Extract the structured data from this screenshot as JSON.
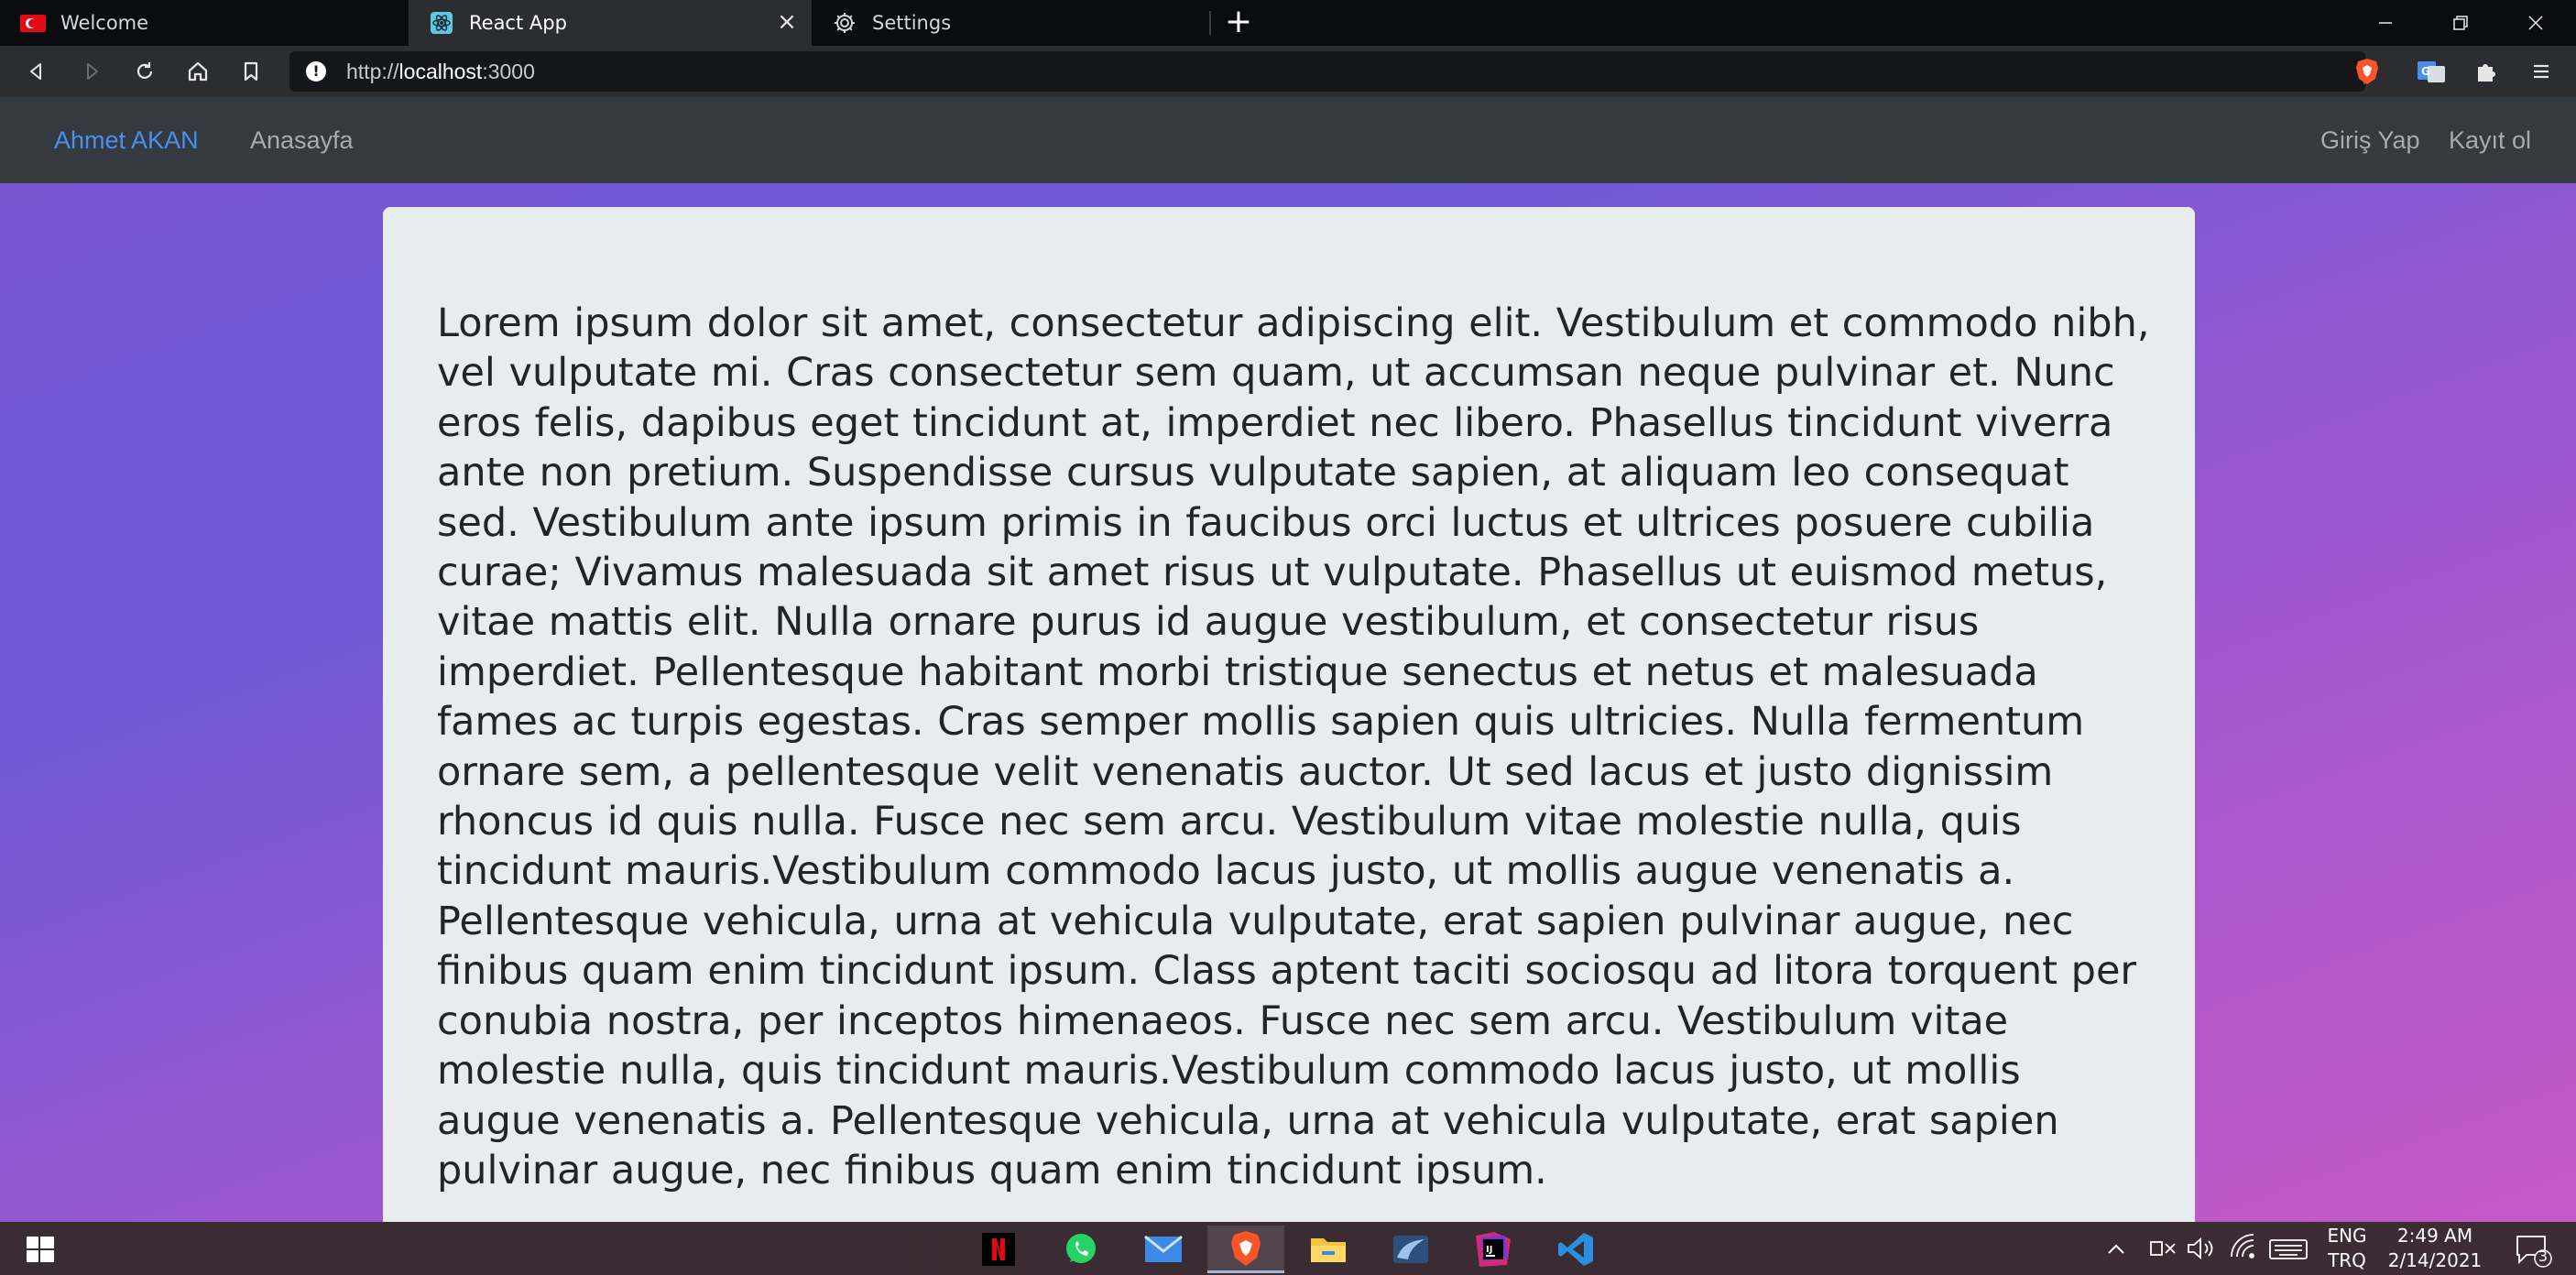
{
  "browser": {
    "tabs": [
      {
        "label": "Welcome",
        "icon": "turkish-flag-icon",
        "active": false
      },
      {
        "label": "React App",
        "icon": "react-logo-icon",
        "active": true
      },
      {
        "label": "Settings",
        "icon": "gear-icon",
        "active": false
      }
    ],
    "url_scheme": "http://",
    "url_host": "localhost",
    "url_port": ":3000"
  },
  "site": {
    "brand": "Ahmet AKAN",
    "nav": {
      "home": "Anasayfa",
      "login": "Giriş Yap",
      "register": "Kayıt ol"
    },
    "colors": {
      "navbar_bg": "#343a40",
      "brand": "#4a8ff0",
      "card_bg": "#e9ecef",
      "gradient_start": "#7a56d2",
      "gradient_end": "#c659c7"
    }
  },
  "content": {
    "paragraph": "Lorem ipsum dolor sit amet, consectetur adipiscing elit. Vestibulum et commodo nibh, vel vulputate mi. Cras consectetur sem quam, ut accumsan neque pulvinar et. Nunc eros felis, dapibus eget tincidunt at, imperdiet nec libero. Phasellus tincidunt viverra ante non pretium. Suspendisse cursus vulputate sapien, at aliquam leo consequat sed. Vestibulum ante ipsum primis in faucibus orci luctus et ultrices posuere cubilia curae; Vivamus malesuada sit amet risus ut vulputate. Phasellus ut euismod metus, vitae mattis elit. Nulla ornare purus id augue vestibulum, et consectetur risus imperdiet. Pellentesque habitant morbi tristique senectus et netus et malesuada fames ac turpis egestas. Cras semper mollis sapien quis ultricies. Nulla fermentum ornare sem, a pellentesque velit venenatis auctor. Ut sed lacus et justo dignissim rhoncus id quis nulla. Fusce nec sem arcu. Vestibulum vitae molestie nulla, quis tincidunt mauris.Vestibulum commodo lacus justo, ut mollis augue venenatis a. Pellentesque vehicula, urna at vehicula vulputate, erat sapien pulvinar augue, nec finibus quam enim tincidunt ipsum. Class aptent taciti sociosqu ad litora torquent per conubia nostra, per inceptos himenaeos. Fusce nec sem arcu. Vestibulum vitae molestie nulla, quis tincidunt mauris.Vestibulum commodo lacus justo, ut mollis augue venenatis a. Pellentesque vehicula, urna at vehicula vulputate, erat sapien pulvinar augue, nec finibus quam enim tincidunt ipsum."
  },
  "taskbar": {
    "apps": [
      "netflix-icon",
      "whatsapp-icon",
      "mail-icon",
      "brave-browser-icon",
      "file-explorer-icon",
      "database-tool-icon",
      "intellij-idea-icon",
      "vscode-icon"
    ],
    "active_app": "brave-browser-icon",
    "language": "ENG",
    "keyboard_layout": "TRQ",
    "time": "2:49 AM",
    "date": "2/14/2021",
    "notification_count": "3"
  }
}
